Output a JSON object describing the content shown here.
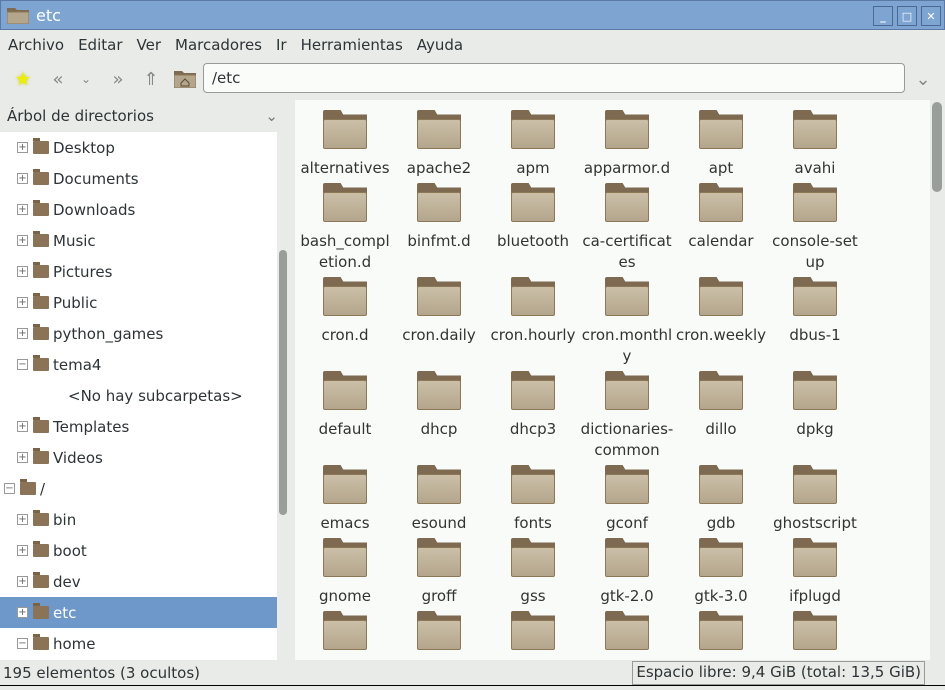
{
  "window": {
    "title": "etc"
  },
  "menu": [
    "Archivo",
    "Editar",
    "Ver",
    "Marcadores",
    "Ir",
    "Herramientas",
    "Ayuda"
  ],
  "address": {
    "value": "/etc"
  },
  "sidebar": {
    "title": "Árbol de directorios",
    "items": [
      {
        "label": "Desktop",
        "level": 1,
        "expander": "+"
      },
      {
        "label": "Documents",
        "level": 1,
        "expander": "+"
      },
      {
        "label": "Downloads",
        "level": 1,
        "expander": "+"
      },
      {
        "label": "Music",
        "level": 1,
        "expander": "+"
      },
      {
        "label": "Pictures",
        "level": 1,
        "expander": "+"
      },
      {
        "label": "Public",
        "level": 1,
        "expander": "+"
      },
      {
        "label": "python_games",
        "level": 1,
        "expander": "+"
      },
      {
        "label": "tema4",
        "level": 1,
        "expander": "−"
      },
      {
        "label": "<No hay subcarpetas>",
        "level": 2,
        "expander": ""
      },
      {
        "label": "Templates",
        "level": 1,
        "expander": "+"
      },
      {
        "label": "Videos",
        "level": 1,
        "expander": "+"
      },
      {
        "label": "/",
        "level": 0,
        "expander": "−"
      },
      {
        "label": "bin",
        "level": 1,
        "expander": "+"
      },
      {
        "label": "boot",
        "level": 1,
        "expander": "+"
      },
      {
        "label": "dev",
        "level": 1,
        "expander": "+"
      },
      {
        "label": "etc",
        "level": 1,
        "expander": "+",
        "selected": true
      },
      {
        "label": "home",
        "level": 1,
        "expander": "−"
      }
    ]
  },
  "files": [
    "alternatives",
    "apache2",
    "apm",
    "apparmor.d",
    "apt",
    "avahi",
    "bash_completion.d",
    "binfmt.d",
    "bluetooth",
    "ca-certificates",
    "calendar",
    "console-setup",
    "cron.d",
    "cron.daily",
    "cron.hourly",
    "cron.monthly",
    "cron.weekly",
    "dbus-1",
    "default",
    "dhcp",
    "dhcp3",
    "dictionaries-common",
    "dillo",
    "dpkg",
    "emacs",
    "esound",
    "fonts",
    "gconf",
    "gdb",
    "ghostscript",
    "gnome",
    "groff",
    "gss",
    "gtk-2.0",
    "gtk-3.0",
    "ifplugd",
    "",
    "",
    "",
    "",
    "",
    ""
  ],
  "status": {
    "count": "195 elementos (3 ocultos)",
    "free_space": "Espacio libre: 9,4 GiB (total: 13,5 GiB)"
  },
  "colors": {
    "titlebar": "#7ea5d2",
    "selection": "#6f98ca",
    "folder": "#b3a68c"
  }
}
